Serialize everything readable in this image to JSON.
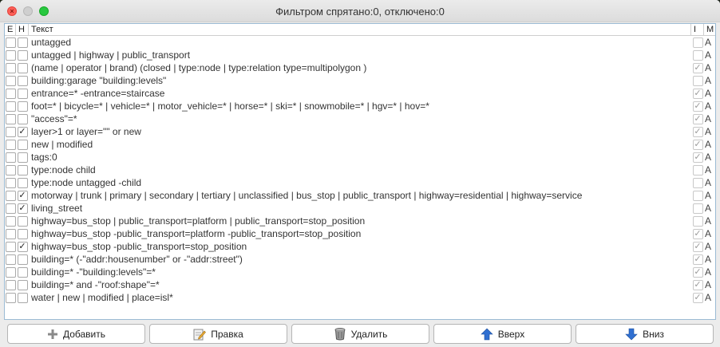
{
  "window": {
    "title": "Фильтром спрятано:0, отключено:0"
  },
  "columns": {
    "e": "E",
    "h": "H",
    "text": "Текст",
    "i": "I",
    "m": "M"
  },
  "rows": [
    {
      "e": false,
      "h": false,
      "text": "untagged",
      "i": false,
      "m": "A"
    },
    {
      "e": false,
      "h": false,
      "text": "untagged | highway | public_transport",
      "i": false,
      "m": "A"
    },
    {
      "e": false,
      "h": false,
      "text": "(name | operator | brand) (closed |  type:node |  type:relation type=multipolygon )",
      "i": true,
      "m": "A"
    },
    {
      "e": false,
      "h": false,
      "text": "building:garage \"building:levels\"",
      "i": false,
      "m": "A"
    },
    {
      "e": false,
      "h": false,
      "text": "entrance=* -entrance=staircase",
      "i": true,
      "m": "A"
    },
    {
      "e": false,
      "h": false,
      "text": "foot=* | bicycle=* | vehicle=* | motor_vehicle=* | horse=* | ski=* | snowmobile=* | hgv=* | hov=*",
      "i": true,
      "m": "A"
    },
    {
      "e": false,
      "h": false,
      "text": "\"access\"=*",
      "i": true,
      "m": "A"
    },
    {
      "e": false,
      "h": true,
      "text": "layer>1 or layer=\"\" or new",
      "i": true,
      "m": "A"
    },
    {
      "e": false,
      "h": false,
      "text": "new | modified",
      "i": true,
      "m": "A"
    },
    {
      "e": false,
      "h": false,
      "text": "tags:0",
      "i": true,
      "m": "A"
    },
    {
      "e": false,
      "h": false,
      "text": "type:node child",
      "i": false,
      "m": "A"
    },
    {
      "e": false,
      "h": false,
      "text": "type:node untagged -child",
      "i": false,
      "m": "A"
    },
    {
      "e": false,
      "h": true,
      "text": "motorway | trunk | primary | secondary | tertiary | unclassified | bus_stop | public_transport | highway=residential | highway=service",
      "i": false,
      "m": "A"
    },
    {
      "e": false,
      "h": true,
      "text": "living_street",
      "i": false,
      "m": "A"
    },
    {
      "e": false,
      "h": false,
      "text": "highway=bus_stop | public_transport=platform | public_transport=stop_position",
      "i": false,
      "m": "A"
    },
    {
      "e": false,
      "h": false,
      "text": "highway=bus_stop -public_transport=platform -public_transport=stop_position",
      "i": true,
      "m": "A"
    },
    {
      "e": false,
      "h": true,
      "text": "highway=bus_stop -public_transport=stop_position",
      "i": true,
      "m": "A"
    },
    {
      "e": false,
      "h": false,
      "text": "building=* (-\"addr:housenumber\" or -\"addr:street\")",
      "i": true,
      "m": "A"
    },
    {
      "e": false,
      "h": false,
      "text": "building=* -\"building:levels\"=*",
      "i": true,
      "m": "A"
    },
    {
      "e": false,
      "h": false,
      "text": "building=* and -\"roof:shape\"=*",
      "i": true,
      "m": "A"
    },
    {
      "e": false,
      "h": false,
      "text": "water | new | modified | place=isl*",
      "i": true,
      "m": "A"
    }
  ],
  "buttons": {
    "add": {
      "label": "Добавить",
      "icon": "plus-icon"
    },
    "edit": {
      "label": "Правка",
      "icon": "edit-icon"
    },
    "delete": {
      "label": "Удалить",
      "icon": "trash-icon"
    },
    "up": {
      "label": "Вверх",
      "icon": "arrow-up-icon"
    },
    "down": {
      "label": "Вниз",
      "icon": "arrow-down-icon"
    }
  },
  "colors": {
    "accent": "#2f6fd1",
    "close": "#ff5f57",
    "zoom": "#28c840",
    "frame": "#9bbbd4"
  }
}
